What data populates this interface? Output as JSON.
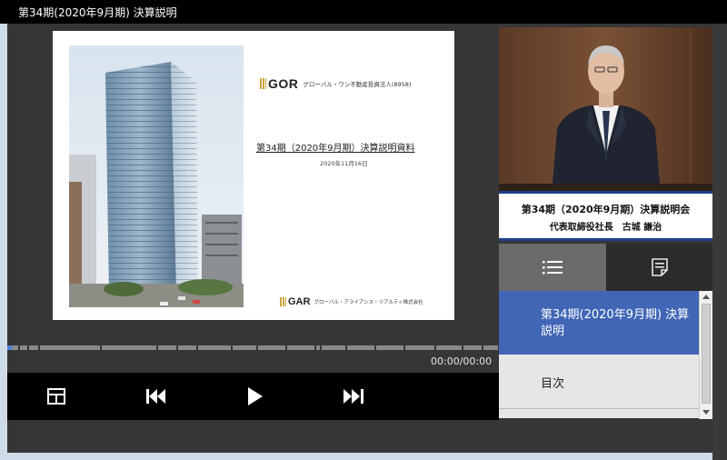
{
  "window": {
    "title": "第34期(2020年9月期) 決算説明"
  },
  "slide": {
    "logo_mark": "GOR",
    "logo_name": "グローバル・ワン不動産投資法人(8958)",
    "title": "第34期（2020年9月期）決算説明資料",
    "date": "2020年11月16日",
    "footer_mark": "GAR",
    "footer_name": "グローバル・アライアンス・リアルティ株式会社"
  },
  "presenter": {
    "caption_title": "第34期（2020年9月期）決算説明会",
    "caption_name": "代表取締役社長　古城 謙治"
  },
  "tabs": [
    {
      "icon": "list-icon",
      "active": true
    },
    {
      "icon": "notes-icon",
      "active": false
    }
  ],
  "chapters": [
    {
      "label": "第34期(2020年9月期) 決算説明",
      "active": true
    },
    {
      "label": "目次",
      "active": false
    }
  ],
  "player": {
    "timecode": "00:00/00:00",
    "progress": 0.0
  },
  "colors": {
    "accent_blue": "#4166b6",
    "caption_border": "#1f3f8a",
    "background": "#363636",
    "logo_gold": "#c9a43a"
  }
}
